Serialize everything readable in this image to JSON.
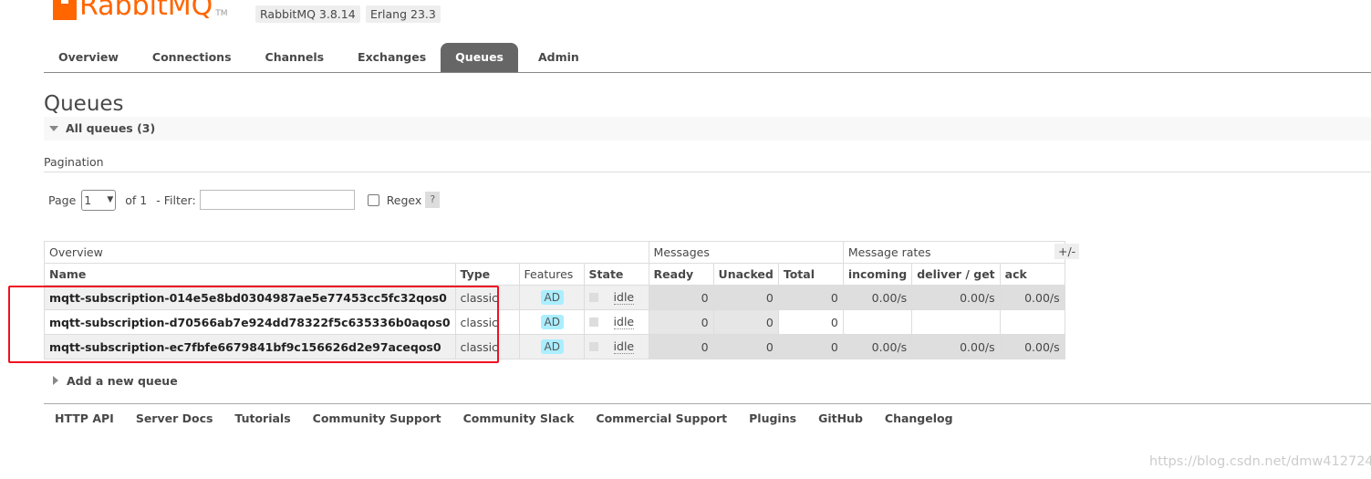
{
  "header": {
    "logo_text": "RabbitMQ",
    "logo_tm": "TM",
    "rabbitmq_version": "RabbitMQ 3.8.14",
    "erlang_version": "Erlang 23.3"
  },
  "tabs": [
    {
      "label": "Overview"
    },
    {
      "label": "Connections"
    },
    {
      "label": "Channels"
    },
    {
      "label": "Exchanges"
    },
    {
      "label": "Queues",
      "active": true
    },
    {
      "label": "Admin"
    }
  ],
  "page_title": "Queues",
  "all_queues_label": "All queues (3)",
  "pagination": {
    "label": "Pagination",
    "page_label": "Page",
    "page_value": "1",
    "of_label": "of 1",
    "filter_label": "- Filter:",
    "filter_value": "",
    "regex_label": "Regex",
    "help_label": "?"
  },
  "table": {
    "groups": {
      "overview": "Overview",
      "messages": "Messages",
      "message_rates": "Message rates"
    },
    "columns": {
      "name": "Name",
      "type": "Type",
      "features": "Features",
      "state": "State",
      "ready": "Ready",
      "unacked": "Unacked",
      "total": "Total",
      "incoming": "incoming",
      "deliver_get": "deliver / get",
      "ack": "ack"
    },
    "plus_minus": "+/-",
    "rows": [
      {
        "name": "mqtt-subscription-014e5e8bd0304987ae5e77453cc5fc32qos0",
        "type": "classic",
        "features": "AD",
        "state": "idle",
        "ready": "0",
        "unacked": "0",
        "total": "0",
        "incoming": "0.00/s",
        "deliver_get": "0.00/s",
        "ack": "0.00/s"
      },
      {
        "name": "mqtt-subscription-d70566ab7e924dd78322f5c635336b0aqos0",
        "type": "classic",
        "features": "AD",
        "state": "idle",
        "ready": "0",
        "unacked": "0",
        "total": "0",
        "incoming": "",
        "deliver_get": "",
        "ack": ""
      },
      {
        "name": "mqtt-subscription-ec7fbfe6679841bf9c156626d2e97aceqos0",
        "type": "classic",
        "features": "AD",
        "state": "idle",
        "ready": "0",
        "unacked": "0",
        "total": "0",
        "incoming": "0.00/s",
        "deliver_get": "0.00/s",
        "ack": "0.00/s"
      }
    ]
  },
  "add_queue_label": "Add a new queue",
  "footer": [
    {
      "label": "HTTP API"
    },
    {
      "label": "Server Docs"
    },
    {
      "label": "Tutorials"
    },
    {
      "label": "Community Support"
    },
    {
      "label": "Community Slack"
    },
    {
      "label": "Commercial Support"
    },
    {
      "label": "Plugins"
    },
    {
      "label": "GitHub"
    },
    {
      "label": "Changelog"
    }
  ],
  "watermark": "https://blog.csdn.net/dmw412724",
  "colors": {
    "brand": "#ff6600",
    "active_tab": "#666666",
    "highlight_box": "#ee1122",
    "feature_badge": "#aaeeff"
  }
}
